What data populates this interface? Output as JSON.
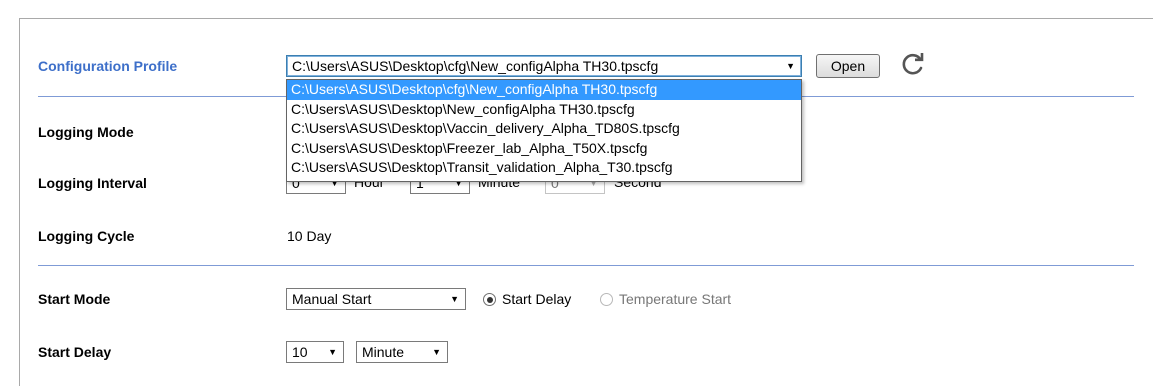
{
  "config": {
    "label": "Configuration Profile",
    "selected": "C:\\Users\\ASUS\\Desktop\\cfg\\New_configAlpha TH30.tpscfg",
    "open_label": "Open",
    "options": [
      "C:\\Users\\ASUS\\Desktop\\cfg\\New_configAlpha TH30.tpscfg",
      "C:\\Users\\ASUS\\Desktop\\New_configAlpha TH30.tpscfg",
      "C:\\Users\\ASUS\\Desktop\\Vaccin_delivery_Alpha_TD80S.tpscfg",
      "C:\\Users\\ASUS\\Desktop\\Freezer_lab_Alpha_T50X.tpscfg",
      "C:\\Users\\ASUS\\Desktop\\Transit_validation_Alpha_T30.tpscfg"
    ]
  },
  "logging_mode": {
    "label": "Logging Mode"
  },
  "logging_interval": {
    "label": "Logging Interval",
    "hour_value": "0",
    "hour_unit": "Hour",
    "minute_value": "1",
    "minute_unit": "Minute",
    "second_value": "0",
    "second_unit": "Second"
  },
  "logging_cycle": {
    "label": "Logging Cycle",
    "value": "10 Day"
  },
  "start_mode": {
    "label": "Start Mode",
    "value": "Manual Start",
    "radio_delay": "Start Delay",
    "radio_temp": "Temperature Start"
  },
  "start_delay": {
    "label": "Start Delay",
    "value": "10",
    "unit": "Minute"
  },
  "colors": {
    "section_label": "#3d6fc9",
    "divider": "#7f9bd6",
    "highlight": "#3399ff"
  }
}
